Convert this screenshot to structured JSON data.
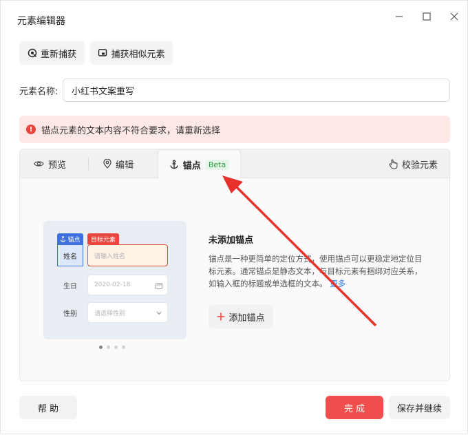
{
  "window": {
    "title": "元素编辑器"
  },
  "toolbar": {
    "recapture_label": "重新捕获",
    "capture_similar_label": "捕获相似元素"
  },
  "name_field": {
    "label": "元素名称:",
    "value": "小红书文案重写"
  },
  "alert": {
    "message": "锚点元素的文本内容不符合要求，请重新选择"
  },
  "tabs": {
    "preview": "预览",
    "edit": "编辑",
    "anchor": "锚点",
    "anchor_badge": "Beta",
    "validate": "校验元素"
  },
  "illustration": {
    "anchor_tag": "锚点",
    "target_tag": "目标元素",
    "name_label": "姓名",
    "name_placeholder": "请输入姓名",
    "birthday_label": "生日",
    "birthday_value": "2020-02-18",
    "gender_label": "性别",
    "gender_placeholder": "请选择性别",
    "carousel_active_index": 0
  },
  "anchor_info": {
    "title": "未添加锚点",
    "description": "锚点是一种更简单的定位方式，使用锚点可以更稳定地定位目标元素。通常锚点是静态文本，与目标元素有捆绑对应关系，如输入框的标题或单选框的文本。",
    "more_link": "更多",
    "add_button": "添加锚点"
  },
  "footer": {
    "help_label": "帮 助",
    "done_label": "完 成",
    "save_continue_label": "保存并继续"
  },
  "colors": {
    "primary_red": "#f04e4c",
    "alert_bg": "#fde8e6",
    "beta_green": "#2f9e44",
    "link_blue": "#2a7be4",
    "anchor_blue": "#3d6fe0"
  }
}
